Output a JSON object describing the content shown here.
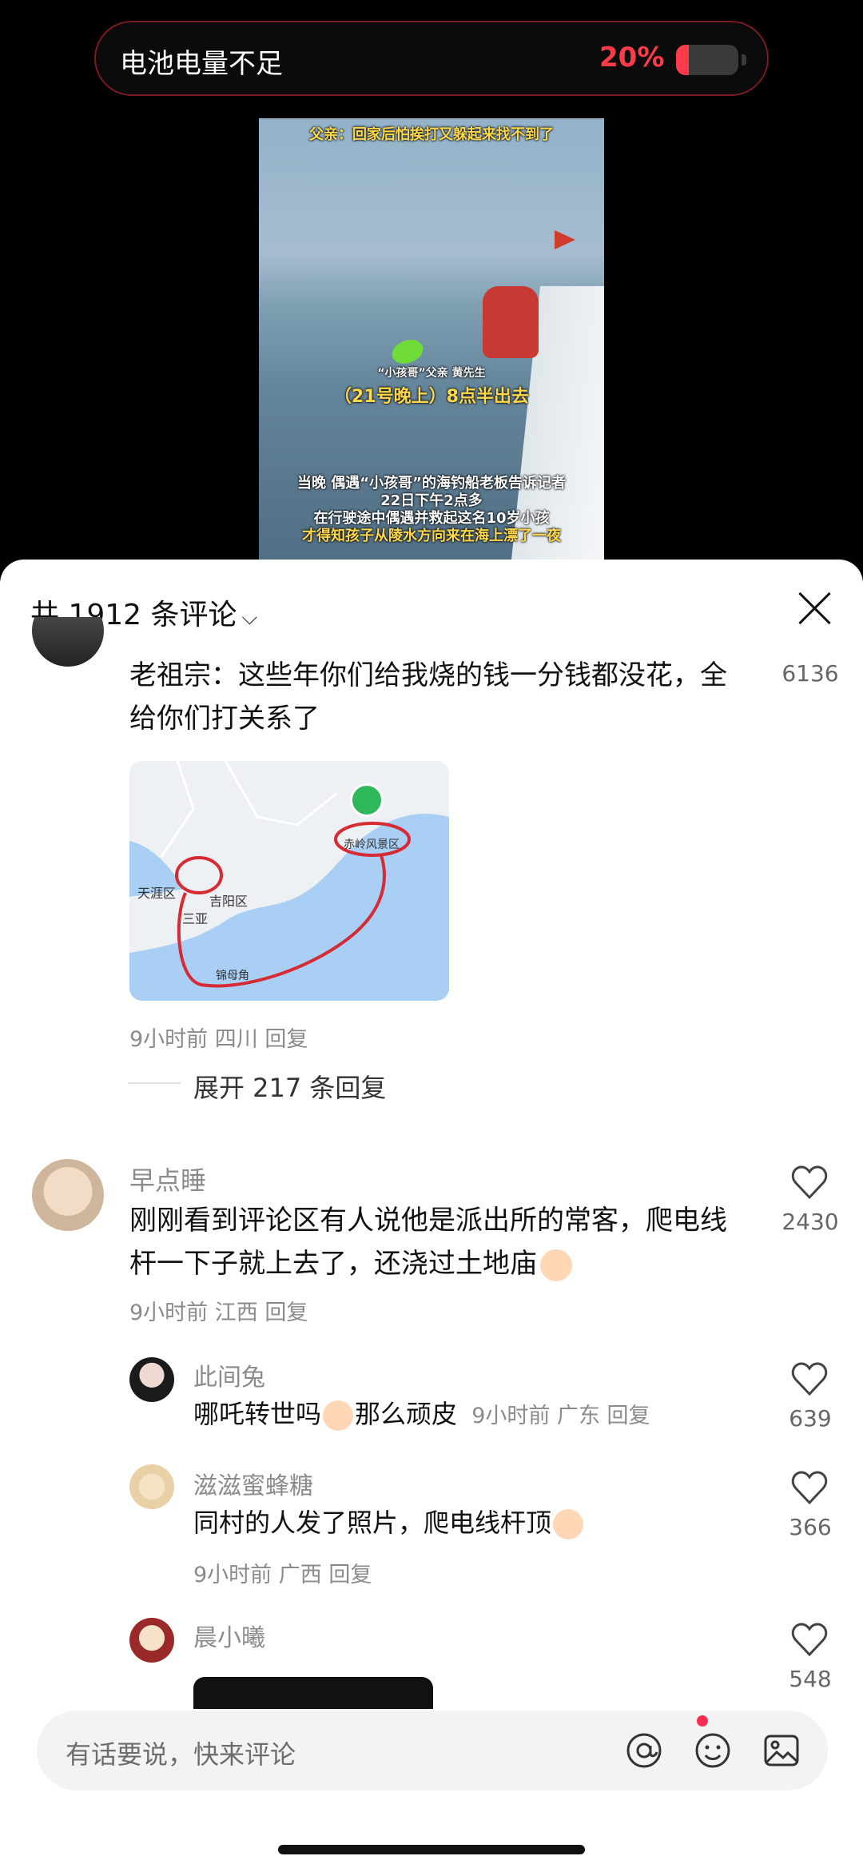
{
  "battery": {
    "label": "电池电量不足",
    "percent_text": "20%",
    "level": 0.2
  },
  "video": {
    "top_caption": "父亲：回家后怕挨打又躲起来找不到了",
    "sub_caption_1": "“小孩哥”父亲 黄先生",
    "sub_caption_2": "（21号晚上）8点半出去",
    "line1": "当晚 偶遇“小孩哥”的海钓船老板告诉记者",
    "line2": "22日下午2点多",
    "line3": "在行驶途中偶遇并救起这名10岁小孩",
    "line4": "才得知孩子从陵水方向来在海上漂了一夜"
  },
  "comments_header": {
    "label": "共 1912 条评论",
    "chevron": "chevron-down-icon"
  },
  "comments": [
    {
      "text_line1": "老祖宗：这些年你们给我烧的钱一分钱都没花，全",
      "text_line2": "给你们打关系了",
      "likes": "6136",
      "meta": "9小时前 四川 回复",
      "expand": "展开 217 条回复",
      "map_labels": {
        "a": "天涯区",
        "b": "吉阳区",
        "c": "三亚",
        "d": "赤岭风景区",
        "e": "锦母角"
      }
    },
    {
      "user": "早点睡",
      "text_line1": "刚刚看到评论区有人说他是派出所的常客，爬电线",
      "text_line2": "杆一下子就上去了，还浇过土地庙",
      "likes": "2430",
      "meta": "9小时前 江西 回复"
    },
    {
      "user": "此间兔",
      "text": "哪吒转世吗",
      "text_after": "那么顽皮",
      "meta": "9小时前 广东 回复",
      "likes": "639"
    },
    {
      "user": "滋滋蜜蜂糖",
      "text": "同村的人发了照片，爬电线杆顶",
      "meta": "9小时前 广西 回复",
      "likes": "366"
    },
    {
      "user": "晨小曦",
      "likes": "548"
    }
  ],
  "input": {
    "placeholder": "有话要说，快来评论"
  },
  "colors": {
    "accent_red": "#ff3b4a",
    "map_route": "#d62b35"
  }
}
